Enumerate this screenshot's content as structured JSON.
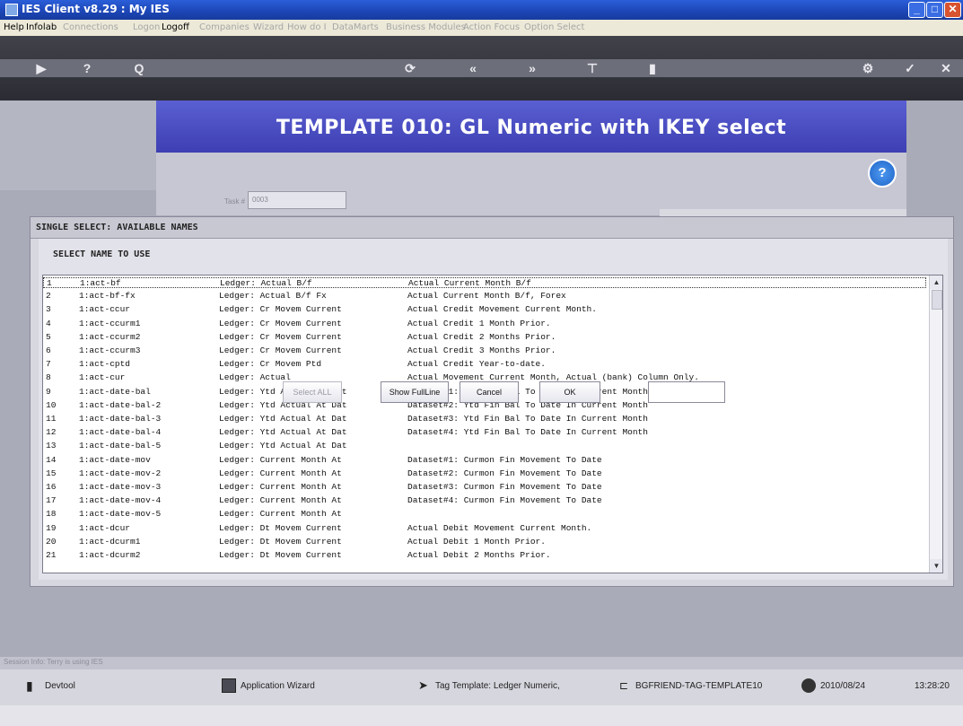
{
  "window": {
    "title": "IES Client v8.29 : My IES"
  },
  "menu": [
    {
      "label": "Help",
      "enabled": true
    },
    {
      "label": "Infolab",
      "enabled": true
    },
    {
      "label": "Connections",
      "enabled": false
    },
    {
      "label": "Logon",
      "enabled": false
    },
    {
      "label": "Logoff",
      "enabled": true
    },
    {
      "label": "Companies",
      "enabled": false
    },
    {
      "label": "Wizard",
      "enabled": false
    },
    {
      "label": "How do I",
      "enabled": false
    },
    {
      "label": "DataMarts",
      "enabled": false
    },
    {
      "label": "Business Modules",
      "enabled": false
    },
    {
      "label": "Action Focus",
      "enabled": false
    },
    {
      "label": "Option Select",
      "enabled": false
    }
  ],
  "toolbar": {
    "icons": [
      "arrow-icon",
      "help-icon",
      "search-icon",
      "refresh-icon",
      "first-icon",
      "last-icon",
      "filter-icon",
      "bookmark-icon",
      "settings-icon",
      "check-icon",
      "close-icon"
    ],
    "glyphs": {
      "arrow": "▶",
      "help": "?",
      "search": "Q",
      "refresh": "⟳",
      "first": "«",
      "last": "»",
      "filter": "⊤",
      "bookmark": "▮",
      "settings": "⚙",
      "check": "✓",
      "close": "✕"
    }
  },
  "banner": {
    "title": "TEMPLATE 010: GL Numeric with IKEY select"
  },
  "help_glyph": "?",
  "task_field": {
    "label": "Task #",
    "value": "0003"
  },
  "dialog": {
    "title": "SINGLE SELECT: AVAILABLE NAMES",
    "select_label": "SELECT NAME TO USE",
    "rows": [
      {
        "n": "1",
        "name": "1:act-bf",
        "ledger": "Ledger: Actual B/f",
        "desc": "Actual Current Month B/f"
      },
      {
        "n": "2",
        "name": "1:act-bf-fx",
        "ledger": "Ledger: Actual B/f Fx",
        "desc": "Actual Current Month B/f, Forex"
      },
      {
        "n": "3",
        "name": "1:act-ccur",
        "ledger": "Ledger: Cr Movem Current",
        "desc": "Actual Credit Movement Current Month."
      },
      {
        "n": "4",
        "name": "1:act-ccurm1",
        "ledger": "Ledger: Cr Movem Current",
        "desc": "Actual Credit 1 Month Prior."
      },
      {
        "n": "5",
        "name": "1:act-ccurm2",
        "ledger": "Ledger: Cr Movem Current",
        "desc": "Actual Credit 2 Months Prior."
      },
      {
        "n": "6",
        "name": "1:act-ccurm3",
        "ledger": "Ledger: Cr Movem Current",
        "desc": "Actual Credit 3 Months Prior."
      },
      {
        "n": "7",
        "name": "1:act-cptd",
        "ledger": "Ledger: Cr Movem Ptd",
        "desc": "Actual Credit Year-to-date."
      },
      {
        "n": "8",
        "name": "1:act-cur",
        "ledger": "Ledger: Actual",
        "desc": "Actual Movement Current Month, Actual (bank) Column Only."
      },
      {
        "n": "9",
        "name": "1:act-date-bal",
        "ledger": "Ledger: Ytd Actual At Dat",
        "desc": "Dataset#1: Ytd Fin Bal To Date In Current Month"
      },
      {
        "n": "10",
        "name": "1:act-date-bal-2",
        "ledger": "Ledger: Ytd Actual At Dat",
        "desc": "Dataset#2: Ytd Fin Bal To Date In Current Month"
      },
      {
        "n": "11",
        "name": "1:act-date-bal-3",
        "ledger": "Ledger: Ytd Actual At Dat",
        "desc": "Dataset#3: Ytd Fin Bal To Date In Current Month"
      },
      {
        "n": "12",
        "name": "1:act-date-bal-4",
        "ledger": "Ledger: Ytd Actual At Dat",
        "desc": "Dataset#4: Ytd Fin Bal To Date In Current Month"
      },
      {
        "n": "13",
        "name": "1:act-date-bal-5",
        "ledger": "Ledger: Ytd Actual At Dat",
        "desc": ""
      },
      {
        "n": "14",
        "name": "1:act-date-mov",
        "ledger": "Ledger: Current Month At",
        "desc": "Dataset#1: Curmon Fin Movement To Date"
      },
      {
        "n": "15",
        "name": "1:act-date-mov-2",
        "ledger": "Ledger: Current Month At",
        "desc": "Dataset#2: Curmon Fin Movement To Date"
      },
      {
        "n": "16",
        "name": "1:act-date-mov-3",
        "ledger": "Ledger: Current Month At",
        "desc": "Dataset#3: Curmon Fin Movement To Date"
      },
      {
        "n": "17",
        "name": "1:act-date-mov-4",
        "ledger": "Ledger: Current Month At",
        "desc": "Dataset#4: Curmon Fin Movement To Date"
      },
      {
        "n": "18",
        "name": "1:act-date-mov-5",
        "ledger": "Ledger: Current Month At",
        "desc": ""
      },
      {
        "n": "19",
        "name": "1:act-dcur",
        "ledger": "Ledger: Dt Movem Current",
        "desc": "Actual Debit Movement Current Month."
      },
      {
        "n": "20",
        "name": "1:act-dcurm1",
        "ledger": "Ledger: Dt Movem Current",
        "desc": "Actual Debit 1 Month Prior."
      },
      {
        "n": "21",
        "name": "1:act-dcurm2",
        "ledger": "Ledger: Dt Movem Current",
        "desc": "Actual Debit 2 Months Prior."
      }
    ],
    "buttons": {
      "select_all": "Select ALL",
      "show_full_line": "Show FullLine",
      "cancel": "Cancel",
      "ok": "OK"
    },
    "input_value": ""
  },
  "session_info": "Session Info: Terry is using IES",
  "statusbar": {
    "devtool": "Devtool",
    "app_wizard": "Application Wizard",
    "tag_template": "Tag Template: Ledger Numeric,",
    "tag_id": "BGFRIEND-TAG-TEMPLATE10",
    "date": "2010/08/24",
    "time": "13:28:20"
  },
  "colors": {
    "banner": "#4a4fc6",
    "toolbar": "#3a3b42",
    "titlebar": "#1c45b5",
    "content_bg": "#a9abb8"
  }
}
